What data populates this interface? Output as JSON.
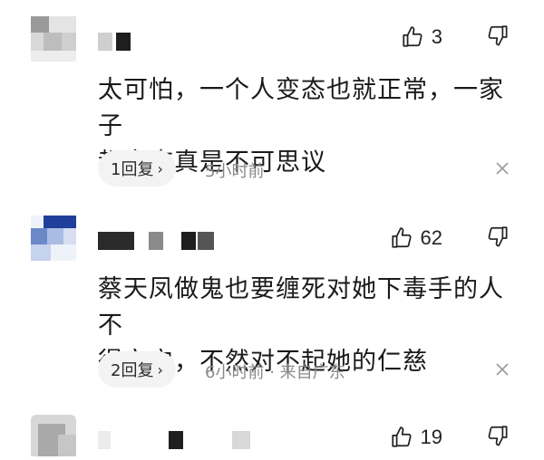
{
  "comments": [
    {
      "likes": "3",
      "text_line1": "太可怕，一个人变态也就正常，一家子",
      "text_line2": "都变态真是不可思议",
      "reply_count": "1回复",
      "chevron": "›",
      "time": "5小时前",
      "location": ""
    },
    {
      "likes": "62",
      "text_line1": "蔡天凤做鬼也要缠死对她下毒手的人不",
      "text_line2": "得安宁，不然对不起她的仁慈",
      "reply_count": "2回复",
      "chevron": "›",
      "time": "6小时前",
      "location": "· 来自广东"
    },
    {
      "likes": "19"
    }
  ],
  "icons": {
    "like": "thumbs-up-icon",
    "dislike": "thumbs-down-icon",
    "close": "close-icon"
  },
  "colors": {
    "pill_bg": "#f3f3f3",
    "meta_text": "#8a8a8a",
    "body_text": "#1a1a1a"
  }
}
